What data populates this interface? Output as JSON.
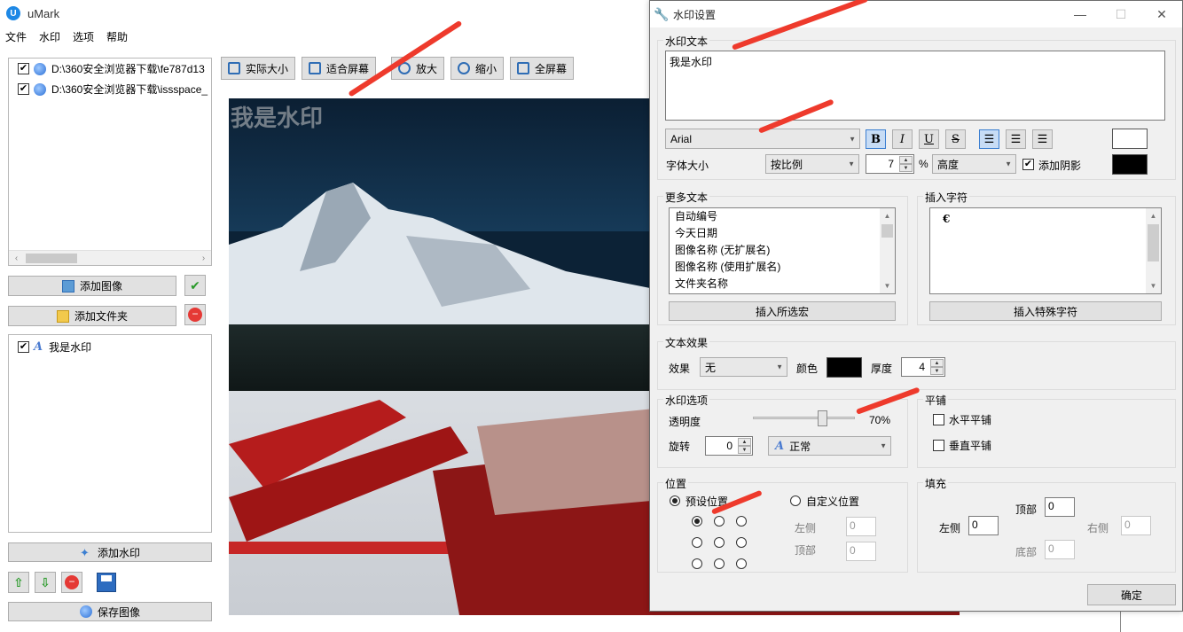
{
  "main": {
    "title": "uMark",
    "menu": [
      "文件",
      "水印",
      "选项",
      "帮助"
    ],
    "files": [
      "D:\\360安全浏览器下载\\fe787d13",
      "D:\\360安全浏览器下载\\issspace_"
    ],
    "buttons": {
      "add_image": "添加图像",
      "add_folder": "添加文件夹",
      "add_watermark": "添加水印",
      "save_image": "保存图像"
    },
    "watermarks": [
      "我是水印"
    ],
    "toolbar": [
      "实际大小",
      "适合屏幕",
      "放大",
      "缩小",
      "全屏幕"
    ],
    "preview_watermark": "我是水印"
  },
  "dialog": {
    "title": "水印设置",
    "watermark_text_label": "水印文本",
    "watermark_text": "我是水印",
    "font": "Arial",
    "format_buttons": [
      "B",
      "I",
      "U",
      "S"
    ],
    "font_size_label": "字体大小",
    "size_mode": "按比例",
    "size_value": "7",
    "percent": "%",
    "size_ref": "高度",
    "shadow_label": "添加阴影",
    "text_color": "#ffffff",
    "shadow_color": "#000000",
    "more_text_label": "更多文本",
    "more_text_items": [
      "自动编号",
      "今天日期",
      "图像名称 (无扩展名)",
      "图像名称 (使用扩展名)",
      "文件夹名称"
    ],
    "insert_selected": "插入所选宏",
    "insert_char_label": "插入字符",
    "special_char": "€",
    "insert_special": "插入特殊字符",
    "text_effect_label": "文本效果",
    "effect_label": "效果",
    "effect_value": "无",
    "color_label": "颜色",
    "effect_color": "#000000",
    "thickness_label": "厚度",
    "thickness_value": "4",
    "wm_options_label": "水印选项",
    "opacity_label": "透明度",
    "opacity_value": "70%",
    "opacity_fraction": 0.7,
    "rotate_label": "旋转",
    "rotate_value": "0",
    "rotate_mode": "正常",
    "tile_label": "平铺",
    "tile_h": "水平平铺",
    "tile_v": "垂直平铺",
    "position_label": "位置",
    "preset_pos": "预设位置",
    "custom_pos": "自定义位置",
    "left_label": "左侧",
    "top_label": "顶部",
    "custom_left": "0",
    "custom_top": "0",
    "fill_label": "填充",
    "fill_top_label": "顶部",
    "fill_top": "0",
    "fill_left_label": "左侧",
    "fill_left": "0",
    "fill_right_label": "右侧",
    "fill_right": "0",
    "fill_bottom_label": "底部",
    "fill_bottom": "0",
    "ok": "确定"
  },
  "accent_color": "#ee3a2c"
}
